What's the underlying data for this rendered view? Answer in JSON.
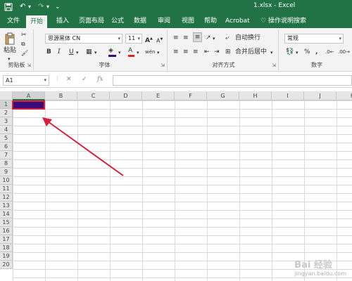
{
  "window": {
    "title": "1.xlsx - Excel",
    "quick_access": {
      "save_icon": "save-icon",
      "undo_icon": "undo-icon",
      "redo_icon": "redo-icon",
      "more": "⌄"
    }
  },
  "tabs": [
    "文件",
    "开始",
    "插入",
    "页面布局",
    "公式",
    "数据",
    "审阅",
    "视图",
    "帮助",
    "Acrobat"
  ],
  "active_tab": "开始",
  "tell_me": "操作说明搜索",
  "ribbon": {
    "clipboard": {
      "paste": "粘贴",
      "label": "剪贴板"
    },
    "font": {
      "name": "思源黑体 CN",
      "size": "11",
      "bold": "B",
      "italic": "I",
      "underline": "U",
      "grow": "A",
      "shrink": "A",
      "font_color": "A",
      "wen": "wén",
      "label": "字体"
    },
    "alignment": {
      "wrap": "自动换行",
      "merge": "合并后居中",
      "label": "对齐方式"
    },
    "number": {
      "format": "常规",
      "percent": "%",
      "comma": ",",
      "label": "数字"
    }
  },
  "formula_bar": {
    "name_box": "A1",
    "cancel": "✕",
    "enter": "✓",
    "fx": "fx",
    "value": ""
  },
  "sheet": {
    "columns": [
      "A",
      "B",
      "C",
      "D",
      "E",
      "F",
      "G",
      "H",
      "I",
      "J",
      "K"
    ],
    "rows": [
      "1",
      "2",
      "3",
      "4",
      "5",
      "6",
      "7",
      "8",
      "9",
      "10",
      "11",
      "12",
      "13",
      "14",
      "15",
      "16",
      "17",
      "18",
      "19",
      "20"
    ],
    "selected_cell": "A1",
    "selected_fill": "#3a0a7a",
    "highlight_color": "#d4203a"
  },
  "colors": {
    "brand": "#217346",
    "arrow": "#d4203a"
  },
  "watermark": {
    "big": "Bai 经验",
    "small": "jingyan.baidu.com"
  }
}
